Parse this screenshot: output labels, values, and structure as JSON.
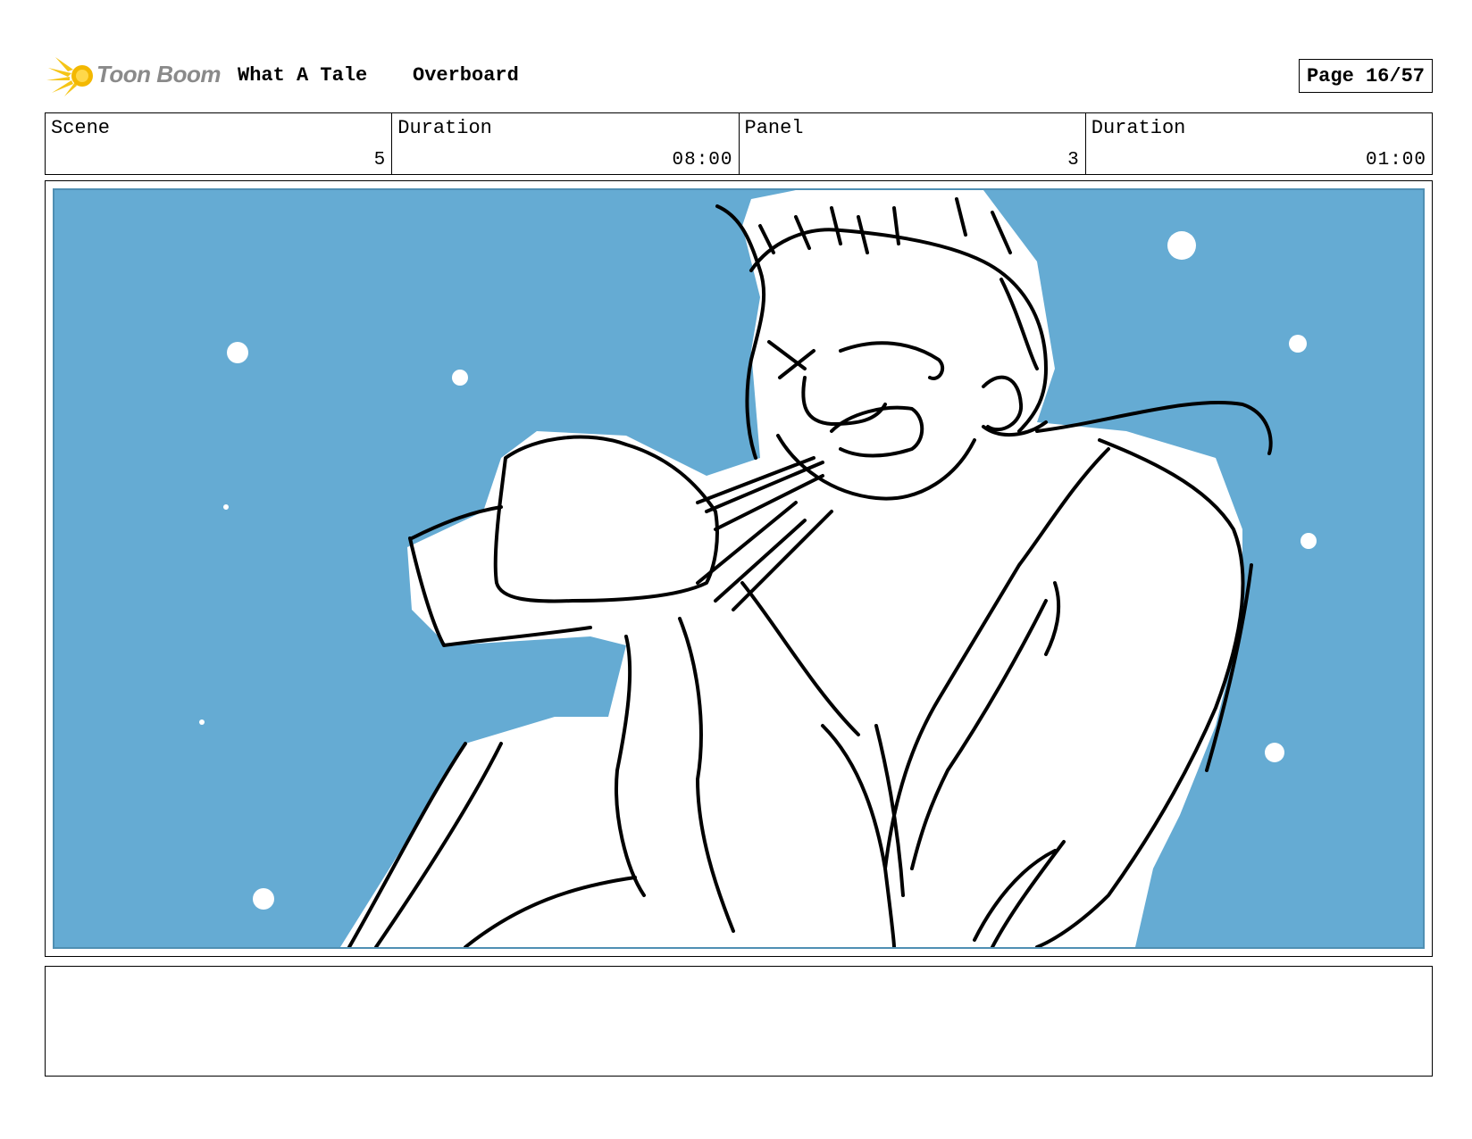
{
  "header": {
    "logo_text": "Toon Boom",
    "project_title": "What A Tale",
    "episode_title": "Overboard",
    "page_label": "Page 16/57"
  },
  "info": [
    {
      "label": "Scene",
      "value": "5"
    },
    {
      "label": "Duration",
      "value": "08:00"
    },
    {
      "label": "Panel",
      "value": "3"
    },
    {
      "label": "Duration",
      "value": "01:00"
    }
  ],
  "panel": {
    "background_color": "#65abd3",
    "content": "sketch-drawing"
  },
  "notes": {
    "text": ""
  }
}
